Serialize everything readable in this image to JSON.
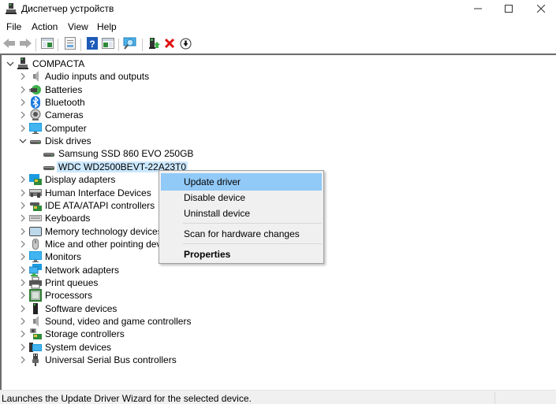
{
  "window": {
    "title": "Диспетчер устройств",
    "controls": {
      "minimize": "minimize",
      "maximize": "maximize",
      "close": "close"
    }
  },
  "menubar": {
    "items": [
      {
        "label": "File"
      },
      {
        "label": "Action"
      },
      {
        "label": "View"
      },
      {
        "label": "Help"
      }
    ]
  },
  "toolbar": {
    "buttons": [
      {
        "name": "back",
        "icon": "arrow-left-icon"
      },
      {
        "name": "forward",
        "icon": "arrow-right-icon"
      },
      {
        "name": "show-hide-console-tree",
        "icon": "console-tree-icon"
      },
      {
        "name": "properties",
        "icon": "properties-icon"
      },
      {
        "name": "help",
        "icon": "help-icon"
      },
      {
        "name": "show-hide-action-pane",
        "icon": "action-pane-icon"
      },
      {
        "name": "scan-hardware",
        "icon": "monitor-scan-icon"
      },
      {
        "name": "update-driver",
        "icon": "update-driver-icon"
      },
      {
        "name": "uninstall-device",
        "icon": "red-x-icon"
      },
      {
        "name": "download",
        "icon": "download-circle-icon"
      }
    ]
  },
  "tree": {
    "root": {
      "label": "COMPACTA",
      "expanded": true,
      "icon": "computer-tower-icon"
    },
    "categories": [
      {
        "label": "Audio inputs and outputs",
        "icon": "speaker-icon",
        "expanded": false
      },
      {
        "label": "Batteries",
        "icon": "battery-icon",
        "expanded": false
      },
      {
        "label": "Bluetooth",
        "icon": "bluetooth-icon",
        "expanded": false
      },
      {
        "label": "Cameras",
        "icon": "camera-icon",
        "expanded": false
      },
      {
        "label": "Computer",
        "icon": "monitor-icon",
        "expanded": false
      },
      {
        "label": "Disk drives",
        "icon": "disk-drive-icon",
        "expanded": true,
        "children": [
          {
            "label": "Samsung SSD 860 EVO 250GB",
            "icon": "disk-drive-icon",
            "selected": false
          },
          {
            "label": "WDC WD2500BEVT-22A23T0",
            "icon": "disk-drive-icon",
            "selected": true
          }
        ]
      },
      {
        "label": "Display adapters",
        "icon": "display-adapter-icon",
        "expanded": false
      },
      {
        "label": "Human Interface Devices",
        "icon": "hid-icon",
        "expanded": false
      },
      {
        "label": "IDE ATA/ATAPI controllers",
        "icon": "ide-controller-icon",
        "expanded": false
      },
      {
        "label": "Keyboards",
        "icon": "keyboard-icon",
        "expanded": false
      },
      {
        "label": "Memory technology devices",
        "icon": "memory-icon",
        "expanded": false
      },
      {
        "label": "Mice and other pointing devices",
        "icon": "mouse-icon",
        "expanded": false
      },
      {
        "label": "Monitors",
        "icon": "monitor-icon",
        "expanded": false
      },
      {
        "label": "Network adapters",
        "icon": "network-icon",
        "expanded": false
      },
      {
        "label": "Print queues",
        "icon": "printer-icon",
        "expanded": false
      },
      {
        "label": "Processors",
        "icon": "processor-icon",
        "expanded": false
      },
      {
        "label": "Software devices",
        "icon": "software-device-icon",
        "expanded": false
      },
      {
        "label": "Sound, video and game controllers",
        "icon": "speaker-icon",
        "expanded": false
      },
      {
        "label": "Storage controllers",
        "icon": "storage-controller-icon",
        "expanded": false
      },
      {
        "label": "System devices",
        "icon": "system-devices-icon",
        "expanded": false
      },
      {
        "label": "Universal Serial Bus controllers",
        "icon": "usb-icon",
        "expanded": false
      }
    ]
  },
  "context_menu": {
    "items": [
      {
        "label": "Update driver",
        "highlighted": true,
        "bold": false
      },
      {
        "label": "Disable device",
        "highlighted": false,
        "bold": false
      },
      {
        "label": "Uninstall device",
        "highlighted": false,
        "bold": false
      },
      {
        "separator": true
      },
      {
        "label": "Scan for hardware changes",
        "highlighted": false,
        "bold": false
      },
      {
        "separator": true
      },
      {
        "label": "Properties",
        "highlighted": false,
        "bold": true
      }
    ]
  },
  "statusbar": {
    "text": "Launches the Update Driver Wizard for the selected device."
  },
  "colors": {
    "selection": "#cce8ff",
    "menu_highlight": "#91c9f7",
    "menu_bg": "#f0f0f0",
    "status_bg": "#f0f0f0"
  }
}
